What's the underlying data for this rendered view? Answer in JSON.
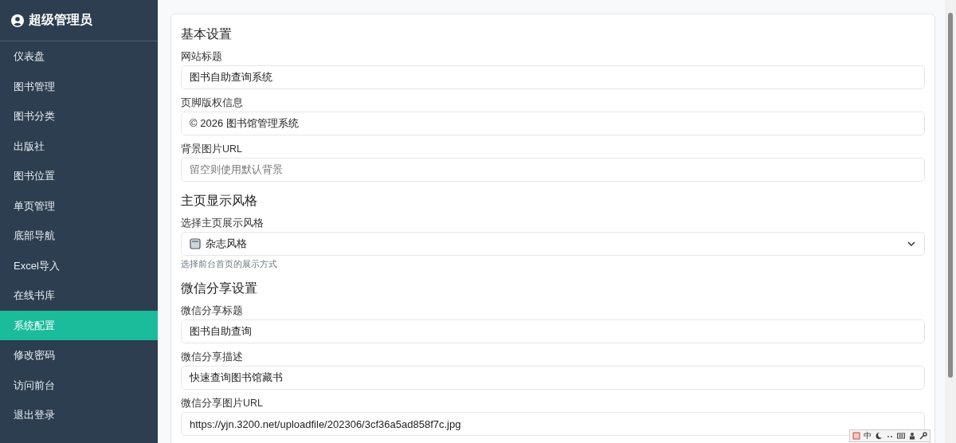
{
  "sidebar": {
    "user": "超级管理员",
    "items": [
      {
        "label": "仪表盘",
        "selected": false
      },
      {
        "label": "图书管理",
        "selected": false
      },
      {
        "label": "图书分类",
        "selected": false
      },
      {
        "label": "出版社",
        "selected": false
      },
      {
        "label": "图书位置",
        "selected": false
      },
      {
        "label": "单页管理",
        "selected": false
      },
      {
        "label": "底部导航",
        "selected": false
      },
      {
        "label": "Excel导入",
        "selected": false
      },
      {
        "label": "在线书库",
        "selected": false
      },
      {
        "label": "系统配置",
        "selected": true
      },
      {
        "label": "修改密码",
        "selected": false
      },
      {
        "label": "访问前台",
        "selected": false
      },
      {
        "label": "退出登录",
        "selected": false
      }
    ]
  },
  "sections": [
    {
      "title": "基本设置",
      "fields": [
        {
          "kind": "text",
          "label": "网站标题",
          "value": "图书自助查询系统"
        },
        {
          "kind": "text",
          "label": "页脚版权信息",
          "value": "© 2026 图书馆管理系统"
        },
        {
          "kind": "text",
          "label": "背景图片URL",
          "placeholder": "留空则使用默认背景"
        }
      ]
    },
    {
      "title": "主页显示风格",
      "fields": [
        {
          "kind": "select",
          "label": "选择主页展示风格",
          "value": "杂志风格",
          "help": "选择前台首页的展示方式"
        }
      ]
    },
    {
      "title": "微信分享设置",
      "fields": [
        {
          "kind": "text",
          "label": "微信分享标题",
          "value": "图书自助查询"
        },
        {
          "kind": "text",
          "label": "微信分享描述",
          "value": "快速查询图书馆藏书"
        },
        {
          "kind": "text",
          "label": "微信分享图片URL",
          "value": "https://yjn.3200.net/uploadfile/202306/3cf36a5ad858f7c.jpg"
        }
      ]
    }
  ],
  "ime": {
    "mode": "中"
  }
}
